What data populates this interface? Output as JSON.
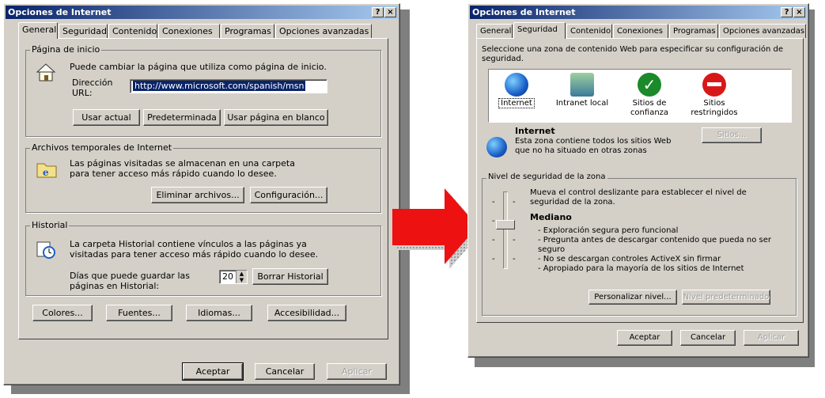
{
  "left_dialog": {
    "title": "Opciones de Internet",
    "help_btn": "?",
    "close_btn": "×",
    "tabs": [
      "General",
      "Seguridad",
      "Contenido",
      "Conexiones",
      "Programas",
      "Opciones avanzadas"
    ],
    "home": {
      "group_title": "Página de inicio",
      "desc": "Puede cambiar la página que utiliza como página de inicio.",
      "addr_label": "Dirección URL:",
      "url": "http://www.microsoft.com/spanish/msn",
      "btn_current": "Usar actual",
      "btn_default": "Predeterminada",
      "btn_blank": "Usar página en blanco"
    },
    "temp": {
      "group_title": "Archivos temporales de Internet",
      "desc": "Las páginas visitadas se almacenan en una carpeta para tener acceso más rápido cuando lo desee.",
      "btn_delete": "Eliminar archivos...",
      "btn_config": "Configuración..."
    },
    "history": {
      "group_title": "Historial",
      "desc": "La carpeta Historial contiene vínculos a las páginas ya visitadas para tener acceso más rápido cuando lo desee.",
      "days_label": "Días que puede guardar las páginas en Historial:",
      "days": "20",
      "btn_clear": "Borrar Historial"
    },
    "bottom": {
      "colors": "Colores...",
      "fonts": "Fuentes...",
      "languages": "Idiomas...",
      "accessibility": "Accesibilidad..."
    },
    "ok": "Aceptar",
    "cancel": "Cancelar",
    "apply": "Aplicar"
  },
  "right_dialog": {
    "title": "Opciones de Internet",
    "help_btn": "?",
    "close_btn": "×",
    "tabs": [
      "General",
      "Seguridad",
      "Contenido",
      "Conexiones",
      "Programas",
      "Opciones avanzadas"
    ],
    "intro": "Seleccione una zona de contenido Web para especificar su configuración de seguridad.",
    "zones": [
      {
        "label": "Internet",
        "icon": "globe-icon"
      },
      {
        "label": "Intranet local",
        "icon": "network-icon"
      },
      {
        "label": "Sitios de confianza",
        "icon": "checkmark-icon"
      },
      {
        "label": "Sitios restringidos",
        "icon": "no-entry-icon"
      }
    ],
    "zone_title": "Internet",
    "zone_desc": "Esta zona contiene todos los sitios Web que no ha situado en otras zonas",
    "sites_btn": "Sitios...",
    "level_group": "Nivel de seguridad de la zona",
    "level_intro": "Mueva el control deslizante para establecer el nivel de seguridad de la zona.",
    "level_name": "Mediano",
    "level_items": [
      "- Exploración segura pero funcional",
      "- Pregunta antes de descargar contenido que pueda no ser seguro",
      "- No se descargan controles ActiveX sin firmar",
      "- Apropiado para la mayoría de los sitios de Internet"
    ],
    "btn_custom": "Personalizar nivel...",
    "btn_default_level": "Nivel predeterminado",
    "ok": "Aceptar",
    "cancel": "Cancelar",
    "apply": "Aplicar"
  },
  "colors": {
    "arrow": "#ee1111",
    "title_start": "#0a246a",
    "title_end": "#a6caf0",
    "face": "#d4d0c8"
  }
}
